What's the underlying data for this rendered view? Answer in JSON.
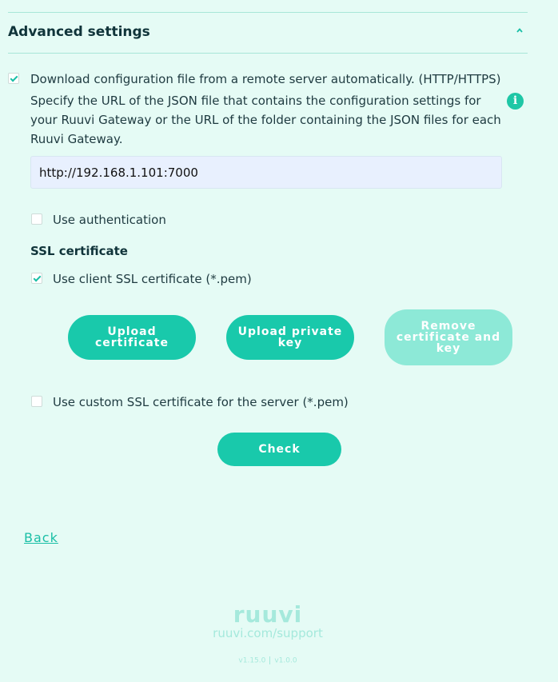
{
  "section": {
    "title": "Advanced settings"
  },
  "remote_config": {
    "checkbox_label": "Download configuration file from a remote server automatically. (HTTP/HTTPS)",
    "checked": true,
    "description": "Specify the URL of the JSON file that contains the configuration settings for your Ruuvi Gateway or the URL of the folder containing the JSON files for each Ruuvi Gateway.",
    "info_icon": "i",
    "url_value": "http://192.168.1.101:7000"
  },
  "authentication": {
    "label": "Use authentication",
    "checked": false
  },
  "ssl": {
    "heading": "SSL certificate",
    "client_cert": {
      "label": "Use client SSL certificate (*.pem)",
      "checked": true
    },
    "buttons": {
      "upload_certificate": "Upload certificate",
      "upload_private_key": "Upload private key",
      "remove_certificate_and_key": "Remove certificate and key"
    },
    "server_cert": {
      "label": "Use custom SSL certificate for the server (*.pem)",
      "checked": false
    }
  },
  "check_button": "Check",
  "back_link": "Back",
  "footer": {
    "logo": "ruuvi",
    "support": "ruuvi.com/support",
    "version_primary": "v1.15.0",
    "version_secondary": "v1.0.0"
  },
  "colors": {
    "background": "#e5fbf5",
    "accent": "#19c9ab",
    "accent_disabled": "#8de9d7",
    "text": "#1e3a40"
  },
  "icons": {
    "collapse": "chevron-up-icon",
    "info": "info-icon",
    "check": "checkmark-icon"
  }
}
